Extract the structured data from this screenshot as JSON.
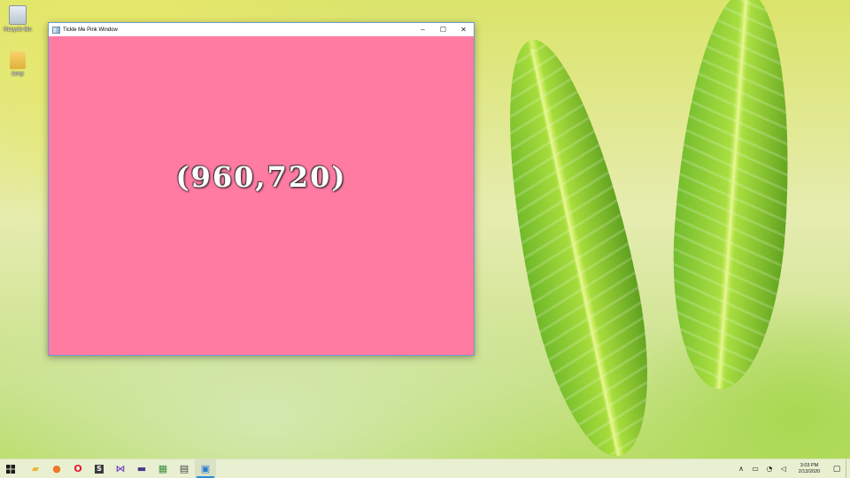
{
  "desktop": {
    "icons": [
      {
        "label": "Recycle Bin",
        "icon": "recycle-bin-icon"
      },
      {
        "label": "temp",
        "icon": "folder-icon"
      }
    ]
  },
  "window": {
    "title": "Tickle Me Pink Window",
    "background": "#ff7ba2",
    "controls": {
      "minimize": "–",
      "maximize": "☐",
      "close": "✕"
    },
    "content_text": "(960,720)"
  },
  "taskbar": {
    "start_icon": "windows-start-icon",
    "apps": [
      {
        "name": "file-explorer-icon",
        "glyph": "▰",
        "color": "#e8b93a"
      },
      {
        "name": "firefox-icon",
        "glyph": "●",
        "color": "#f0772a"
      },
      {
        "name": "opera-icon",
        "glyph": "O",
        "color": "#e21a2c"
      },
      {
        "name": "sublime-text-icon",
        "glyph": "S",
        "color": "#ff8a00"
      },
      {
        "name": "visual-studio-icon",
        "glyph": "⋈",
        "color": "#7a4fbf"
      },
      {
        "name": "terminal-icon",
        "glyph": "▬",
        "color": "#4a3a8a"
      },
      {
        "name": "paint-icon",
        "glyph": "▦",
        "color": "#3c8f3c"
      },
      {
        "name": "calculator-icon",
        "glyph": "▤",
        "color": "#444444"
      },
      {
        "name": "app-window-icon",
        "glyph": "▣",
        "color": "#2a7fd0"
      }
    ],
    "tray": {
      "chevron": "∧",
      "clock_time": "3:03 PM",
      "clock_date": "2/13/2020"
    }
  }
}
